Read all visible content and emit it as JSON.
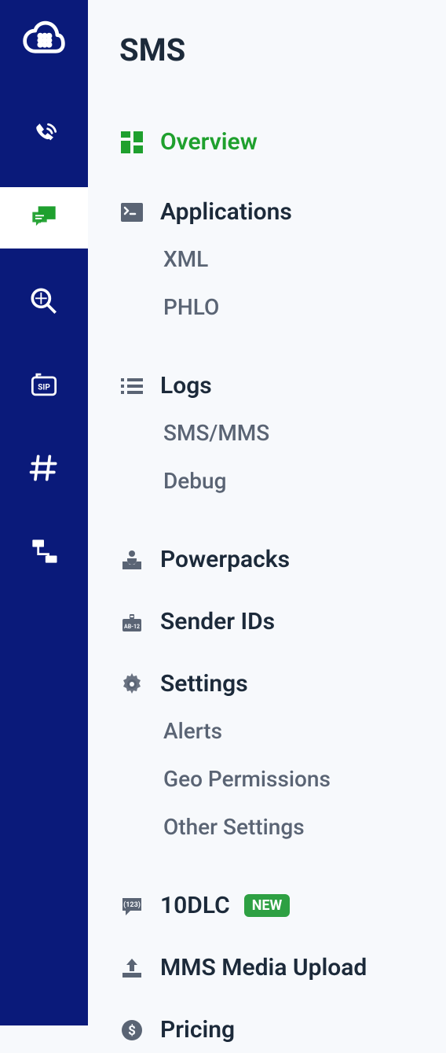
{
  "panel_title": "SMS",
  "nav": {
    "overview": "Overview",
    "applications": {
      "label": "Applications",
      "xml": "XML",
      "phlo": "PHLO"
    },
    "logs": {
      "label": "Logs",
      "smsmms": "SMS/MMS",
      "debug": "Debug"
    },
    "powerpacks": "Powerpacks",
    "senderids": "Sender IDs",
    "settings": {
      "label": "Settings",
      "alerts": "Alerts",
      "geo": "Geo Permissions",
      "other": "Other Settings"
    },
    "tendlc": {
      "label": "10DLC",
      "badge": "NEW"
    },
    "mmsupload": "MMS Media Upload",
    "pricing": "Pricing"
  }
}
